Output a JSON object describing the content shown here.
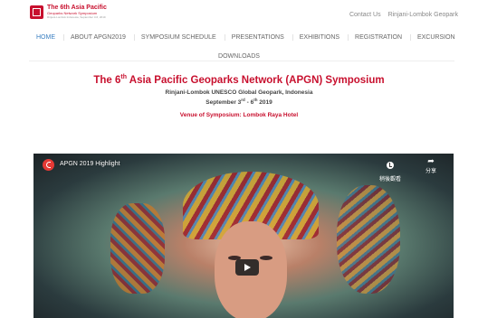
{
  "header": {
    "logo_title": "The 6th Asia Pacific",
    "logo_subtitle": "Geoparks Network Symposium",
    "logo_subtitle2": "Rinjani-Lombok Indonesia, September 3-6, 2019",
    "links": [
      "Contact Us",
      "Rinjani-Lombok Geopark"
    ]
  },
  "nav": {
    "items": [
      "HOME",
      "ABOUT APGN2019",
      "SYMPOSIUM SCHEDULE",
      "PRESENTATIONS",
      "EXHIBITIONS",
      "REGISTRATION",
      "EXCURSION"
    ],
    "second_row": "DOWNLOADS",
    "active": "HOME"
  },
  "main": {
    "title_pre": "The 6",
    "title_sup": "th",
    "title_post": " Asia Pacific Geoparks Network (APGN) Symposium",
    "subtitle_line1": "Rinjani-Lombok UNESCO Global Geopark, Indonesia",
    "subtitle_line2_a": "September 3",
    "subtitle_line2_sup1": "rd",
    "subtitle_line2_b": " - 6",
    "subtitle_line2_sup2": "th",
    "subtitle_line2_c": " 2019",
    "venue": "Venue of Symposium: Lombok Raya Hotel"
  },
  "video": {
    "title": "APGN 2019 Highlight",
    "watch_later": "稍後觀看",
    "share": "分享"
  }
}
